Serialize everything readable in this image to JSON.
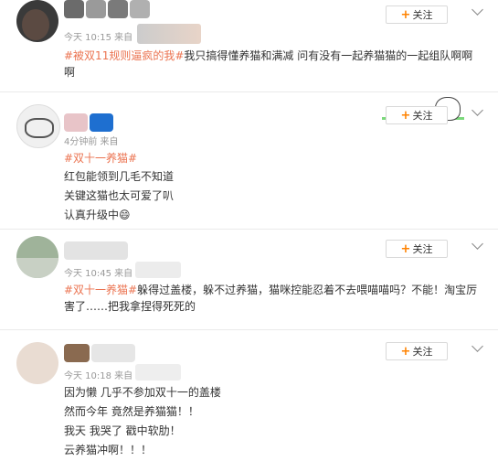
{
  "follow_label": "关注",
  "colors": {
    "accent": "#ff8200",
    "topic": "#eb7350",
    "meta": "#999999"
  },
  "posts": [
    {
      "time": "今天 10:15 来自",
      "topic": "#被双11规则逼疯的我#",
      "body": "我只搞得懂养猫和满减 问有没有一起养猫猫的一起组队啊啊啊"
    },
    {
      "time": "4分钟前 来自",
      "topic": "#双十一养猫#",
      "lines": [
        "红包能领到几毛不知道",
        "关键这猫也太可爱了叭",
        "认真升级中😄"
      ]
    },
    {
      "time": "今天 10:45 来自",
      "topic": "#双十一养猫#",
      "body": "躲得过盖楼，躲不过养猫，猫咪控能忍着不去喂喵喵吗？不能！淘宝厉害了……把我拿捏得死死的"
    },
    {
      "time": "今天 10:18 来自",
      "lines": [
        "因为懒 几乎不参加双十一的盖楼",
        "然而今年 竟然是养猫猫！！",
        "我天 我哭了 戳中软肋！",
        "云养猫冲啊！！！"
      ]
    }
  ]
}
